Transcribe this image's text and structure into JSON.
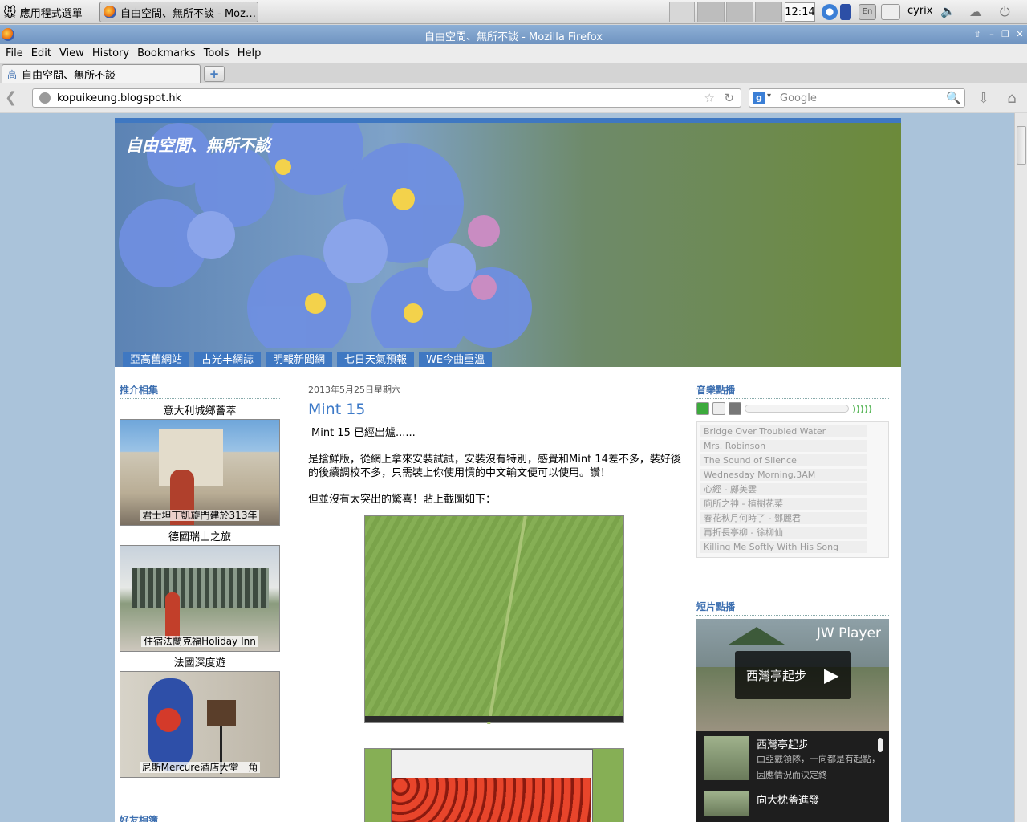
{
  "taskbar": {
    "apps_menu_label": "應用程式選單",
    "task_window_label": "自由空間、無所不談 - Moz…",
    "clock": "12:14",
    "keyboard_label": "En",
    "username": "cyrix"
  },
  "window": {
    "title": "自由空間、無所不談 - Mozilla Firefox"
  },
  "menubar": {
    "items": [
      "File",
      "Edit",
      "View",
      "History",
      "Bookmarks",
      "Tools",
      "Help"
    ],
    "mnemonics": [
      "F",
      "E",
      "V",
      "H",
      "B",
      "T",
      "H"
    ]
  },
  "tabs": [
    {
      "label": "自由空間、無所不談",
      "icon": "blogger-icon",
      "active": true
    }
  ],
  "navbar": {
    "url": "kopuikeung.blogspot.hk",
    "search_placeholder": "Google",
    "search_engine": "google-icon"
  },
  "blog": {
    "title": "自由空間、無所不談",
    "nav_links": [
      "亞高舊網站",
      "古光丰網誌",
      "明報新聞網",
      "七日天氣預報",
      "WE今曲重溫"
    ],
    "accent_color": "#3f78c2",
    "left": {
      "albums_title": "推介相集",
      "albums": [
        {
          "title": "意大利城鄉薈萃",
          "caption": "君士坦丁凱旋門建於313年"
        },
        {
          "title": "德國瑞士之旅",
          "caption": "住宿法蘭克福Holiday Inn"
        },
        {
          "title": "法國深度遊",
          "caption": "尼斯Mercure酒店大堂一角"
        }
      ],
      "friends_title": "好友相簿"
    },
    "post": {
      "date": "2013年5月25日星期六",
      "title": "Mint 15",
      "paragraphs": [
        "Mint 15 已經出爐......",
        "是搶鮮版，從網上拿來安裝試試，安裝沒有特別，感覺和Mint 14差不多，裝好後的後續調校不多，只需裝上你使用慣的中文輸文便可以使用。讚！",
        "但並沒有太突出的驚喜！貼上截圖如下："
      ]
    },
    "right": {
      "music_title": "音樂點播",
      "playlist": [
        "Bridge Over Troubled Water",
        "Mrs. Robinson",
        "The Sound of Silence",
        "Wednesday Morning,3AM",
        "心經 - 鄺美雲",
        "廁所之神 - 植樹花菜",
        "春花秋月何時了 - 鄧麗君",
        "再折長亭柳 - 徐柳仙",
        "Killing Me Softly With His Song"
      ],
      "video_title": "短片點播",
      "video_player_label": "JW Player",
      "video_overlay_title": "西灣亭起步",
      "video_list": [
        {
          "title": "西灣亭起步",
          "desc": "由亞戴領隊，一向都是有起點，因應情況而決定終"
        },
        {
          "title": "向大枕蓋進發",
          "desc": ""
        }
      ]
    }
  }
}
